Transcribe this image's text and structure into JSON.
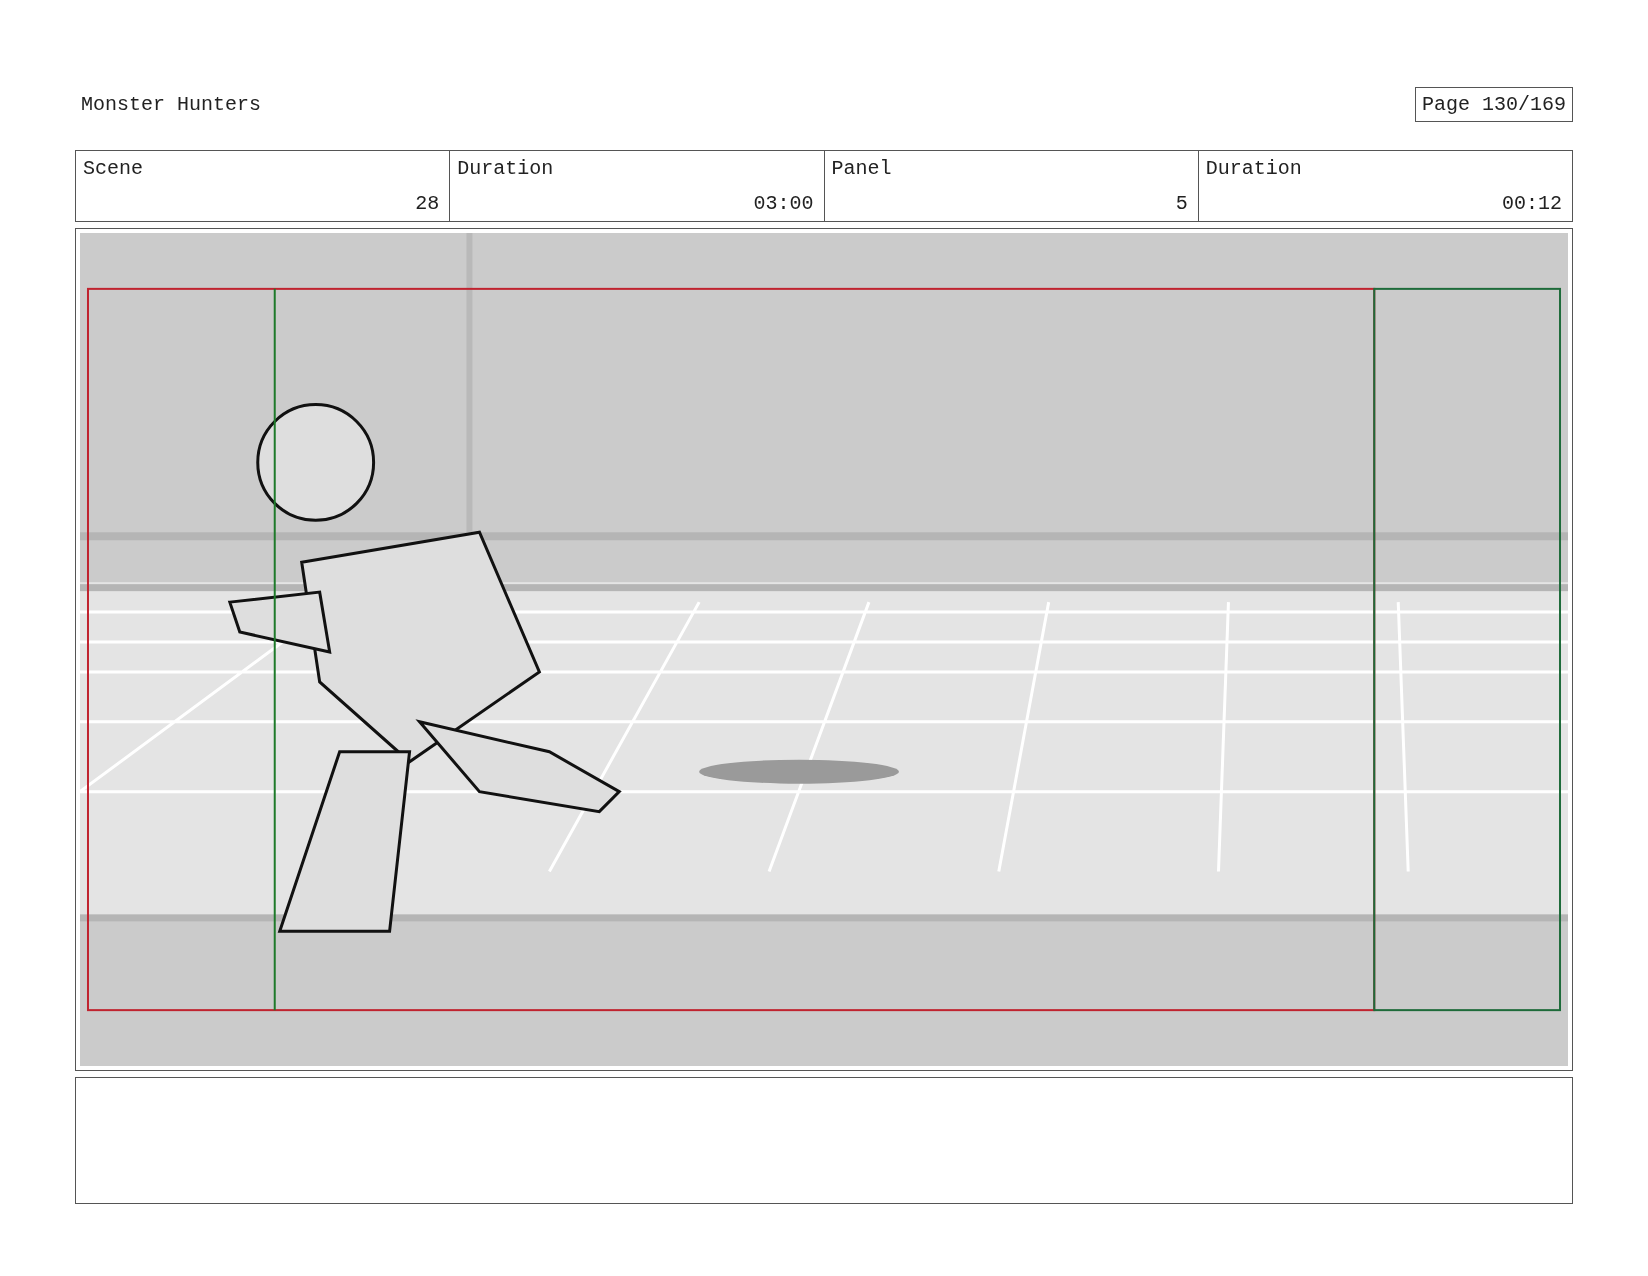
{
  "header": {
    "title": "Monster Hunters",
    "page": "Page 130/169"
  },
  "fields": [
    {
      "label": "Scene",
      "value": "28"
    },
    {
      "label": "Duration",
      "value": "03:00"
    },
    {
      "label": "Panel",
      "value": "5"
    },
    {
      "label": "Duration",
      "value": "00:12"
    }
  ]
}
